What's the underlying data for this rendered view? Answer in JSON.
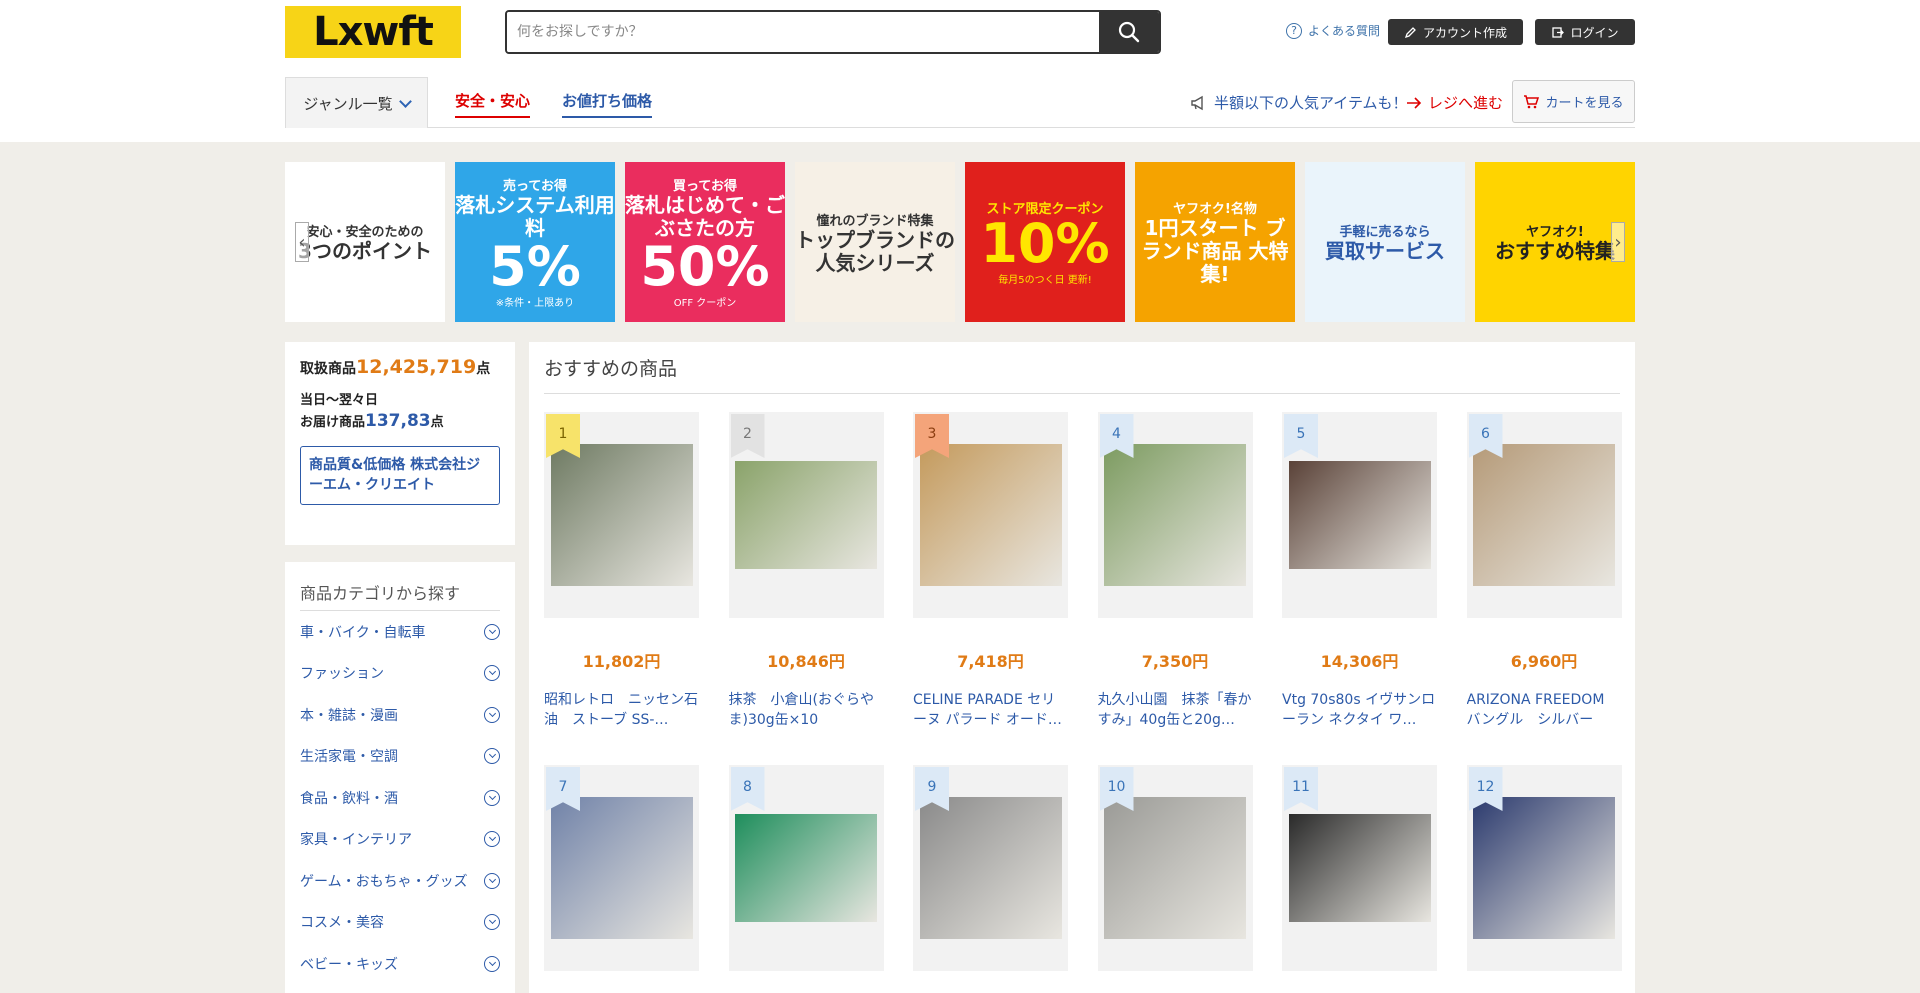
{
  "brand": {
    "logo_text": "Lxwft"
  },
  "search": {
    "placeholder": "何をお探しですか？"
  },
  "header": {
    "help": "よくある質問",
    "create_account": "アカウント作成",
    "login": "ログイン"
  },
  "nav": {
    "genre": "ジャンル一覧",
    "safe": "安全・安心",
    "deal": "お値打ち価格",
    "promo": "半額以下の人気アイテムも！",
    "register": "レジへ進む",
    "cart": "カートを見る"
  },
  "banners": [
    {
      "l1": "安心・安全のための",
      "l2": "3つのポイント",
      "bg": "#ffffff",
      "fg": "#333333"
    },
    {
      "l1": "売ってお得",
      "l2": "落札システム利用料",
      "big": "5%",
      "sm": "※条件・上限あり",
      "bg": "#2fa6e8",
      "fg": "#ffffff"
    },
    {
      "l1": "買ってお得",
      "l2": "落札はじめて・ごぶさたの方",
      "big": "50%",
      "sm": "OFF クーポン",
      "bg": "#ea2d5e",
      "fg": "#ffffff"
    },
    {
      "l1": "憧れのブランド特集",
      "l2": "トップブランドの人気シリーズ",
      "bg": "#f6f0e6",
      "fg": "#333333"
    },
    {
      "l1": "ストア限定クーポン",
      "big": "10%",
      "sm": "毎月5のつく日 更新!",
      "bg": "#e0201c",
      "fg": "#ffe600"
    },
    {
      "l1": "ヤフオク!名物",
      "l2": "1円スタート ブランド商品 大特集!",
      "bg": "#f5a300",
      "fg": "#ffffff"
    },
    {
      "l1": "手軽に売るなら",
      "l2": "買取サービス",
      "bg": "#eaf4fb",
      "fg": "#2d5aa8"
    },
    {
      "l1": "ヤフオク!",
      "l2": "おすすめ特集",
      "bg": "#ffd400",
      "fg": "#222222"
    }
  ],
  "stats": {
    "label1": "取扱商品",
    "count": "12,425,719",
    "unit1": "点",
    "label2a": "当日〜翌々日",
    "label2b": "お届け商品",
    "count2": "137,83",
    "unit2": "点",
    "corp": "商品質&低価格 株式会社ジーエム・クリエイト"
  },
  "categories": {
    "title": "商品カテゴリから探す",
    "items": [
      "車・バイク・自転車",
      "ファッション",
      "本・雑誌・漫画",
      "生活家電・空調",
      "食品・飲料・酒",
      "家具・インテリア",
      "ゲーム・おもちゃ・グッズ",
      "コスメ・美容",
      "ベビー・キッズ"
    ]
  },
  "main": {
    "title": "おすすめの商品"
  },
  "products": [
    {
      "rank": "1",
      "price": "11,802円",
      "title": "昭和レトロ　ニッセン石油　ストーブ SS-…",
      "color": "#6e7a62"
    },
    {
      "rank": "2",
      "price": "10,846円",
      "title": "抹茶　小倉山(おぐらやま)30g缶×10",
      "color": "#8aa36a"
    },
    {
      "rank": "3",
      "price": "7,418円",
      "title": "CELINE PARADE セリーヌ パラード オード…",
      "color": "#c49a5c"
    },
    {
      "rank": "4",
      "price": "7,350円",
      "title": "丸久小山園　抹茶「春かすみ」40g缶と20g…",
      "color": "#7c9b60"
    },
    {
      "rank": "5",
      "price": "14,306円",
      "title": "Vtg 70s80s イヴサンローラン ネクタイ ワ…",
      "color": "#5a4238"
    },
    {
      "rank": "6",
      "price": "6,960円",
      "title": "ARIZONA FREEDOM バングル　シルバー",
      "color": "#b59a78"
    },
    {
      "rank": "7",
      "price": "",
      "title": "",
      "color": "#7082a8"
    },
    {
      "rank": "8",
      "price": "",
      "title": "",
      "color": "#1e8e5c"
    },
    {
      "rank": "9",
      "price": "",
      "title": "",
      "color": "#8a8a8a"
    },
    {
      "rank": "10",
      "price": "",
      "title": "",
      "color": "#9a9a96"
    },
    {
      "rank": "11",
      "price": "",
      "title": "",
      "color": "#2a2a2a"
    },
    {
      "rank": "12",
      "price": "",
      "title": "",
      "color": "#2b3a6e"
    }
  ],
  "rank_colors": {
    "1": "#f7e36a",
    "2": "#e2e2e2",
    "3": "#f4a47a",
    "other": "#dce9f6"
  }
}
